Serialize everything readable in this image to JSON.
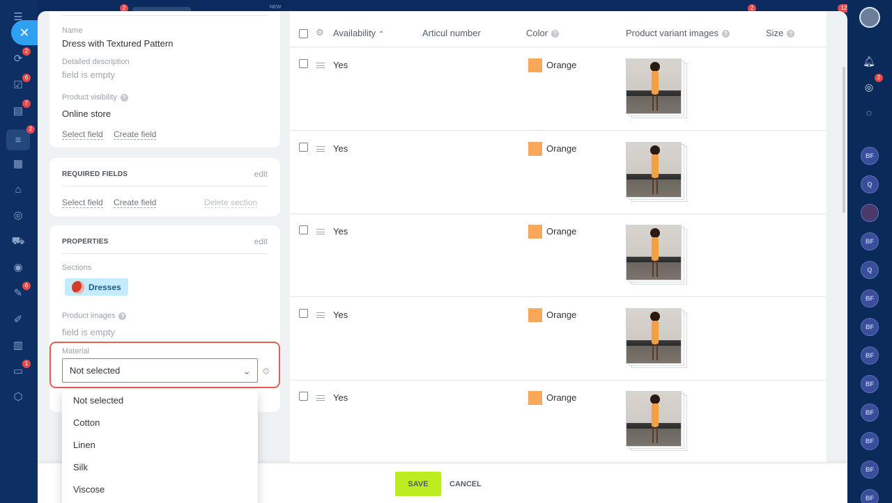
{
  "top_bar": {
    "new_label": "NEW",
    "badge_left": "2",
    "badge_mid": "2",
    "badge_right": "12"
  },
  "left_sidebar": {
    "badges": {
      "deals": "2",
      "tasks": "6",
      "chat": "7",
      "crm": "2",
      "analytics": "6",
      "sites": "1"
    }
  },
  "right_sidebar": {
    "notifications_badge": "2",
    "avatars": [
      "BF",
      "Q",
      "",
      "BF",
      "Q",
      "BF",
      "BF",
      "BF",
      "BF",
      "BF",
      "BF",
      "BF",
      "BF"
    ]
  },
  "product_card": {
    "name_label": "Name",
    "name_value": "Dress with Textured Pattern",
    "description_label": "Detailed description",
    "description_value": "field is empty",
    "visibility_label": "Product visibility",
    "visibility_value": "Online store",
    "select_field": "Select field",
    "create_field": "Create field"
  },
  "required_section": {
    "title": "REQUIRED FIELDS",
    "edit": "edit",
    "select_field": "Select field",
    "create_field": "Create field",
    "delete_section": "Delete section"
  },
  "properties_section": {
    "title": "PROPERTIES",
    "edit": "edit",
    "sections_label": "Sections",
    "section_tag": "Dresses",
    "images_label": "Product images",
    "images_value": "field is empty",
    "material_label": "Material",
    "material_value": "Not selected"
  },
  "material_dropdown": {
    "options": [
      "Not selected",
      "Cotton",
      "Linen",
      "Silk",
      "Viscose"
    ]
  },
  "variants_table": {
    "columns": {
      "availability": "Availability",
      "articul": "Articul number",
      "color": "Color",
      "images": "Product variant images",
      "size": "Size"
    },
    "rows": [
      {
        "availability": "Yes",
        "color": "Orange"
      },
      {
        "availability": "Yes",
        "color": "Orange"
      },
      {
        "availability": "Yes",
        "color": "Orange"
      },
      {
        "availability": "Yes",
        "color": "Orange"
      },
      {
        "availability": "Yes",
        "color": "Orange"
      }
    ],
    "swatch_color": "#f9a85a"
  },
  "footer": {
    "save": "SAVE",
    "cancel": "CANCEL"
  },
  "colors": {
    "accent": "#2fa1f0",
    "save_button": "#bbed21",
    "highlight": "#ea5a4f"
  }
}
